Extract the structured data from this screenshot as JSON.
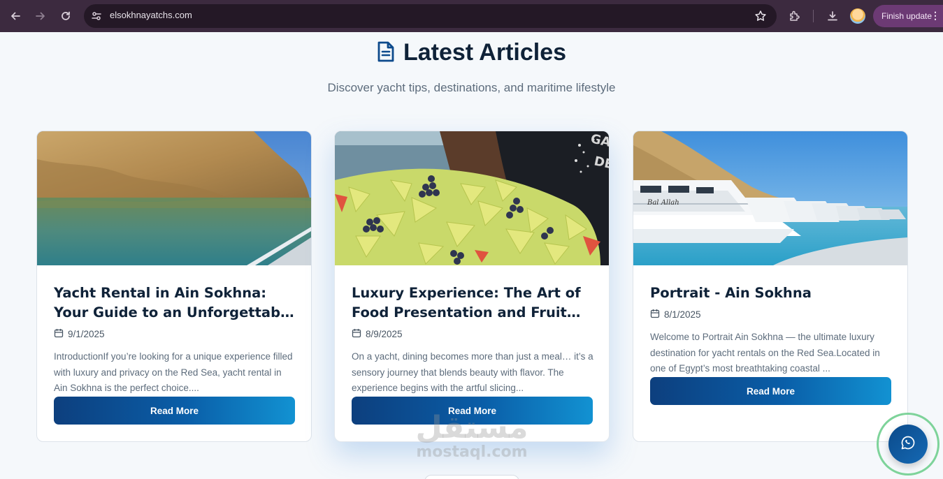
{
  "browser": {
    "url": "elsokhnayatchs.com",
    "finish_update_label": "Finish update",
    "icons": [
      "back-icon",
      "forward-icon",
      "reload-icon",
      "site-settings-icon",
      "bookmark-star-icon",
      "extensions-icon",
      "download-icon",
      "profile-avatar",
      "more-menu-icon"
    ]
  },
  "section": {
    "title": "Latest Articles",
    "subtitle": "Discover yacht tips, destinations, and maritime lifestyle",
    "icon": "document-icon"
  },
  "articles": [
    {
      "title": "Yacht Rental in Ain Sokhna: Your Guide to an Unforgettable Sea Trip",
      "date": "9/1/2025",
      "excerpt": "IntroductionIf you’re looking for a unique experience filled with luxury and privacy on the Red Sea, yacht rental in Ain Sokhna is the perfect choice....",
      "button": "Read More"
    },
    {
      "title": "Luxury Experience: The Art of Food Presentation and Fruit Carving on...",
      "date": "8/9/2025",
      "excerpt": "On a yacht, dining becomes more than just a meal… it’s a sensory journey that blends beauty with flavor. The experience begins with the artful slicing...",
      "button": "Read More"
    },
    {
      "title": "Portrait - Ain Sokhna",
      "date": "8/1/2025",
      "excerpt": "Welcome to Portrait Ain Sokhna — the ultimate luxury destination for yacht rentals on the Red Sea.Located in one of Egypt’s most breathtaking coastal ...",
      "button": "Read More"
    }
  ],
  "watermark": {
    "arabic": "مستقل",
    "latin": "mostaql.com"
  },
  "floating": {
    "icon": "whatsapp-icon"
  },
  "colors": {
    "browser_frame": "#3c2a3f",
    "omnibox": "#241826",
    "finish_update": "#6c3a74",
    "heading": "#0f2238",
    "button_start": "#0d3f7e",
    "button_end": "#1292d2",
    "whatsapp_ring": "#7ed39a"
  }
}
